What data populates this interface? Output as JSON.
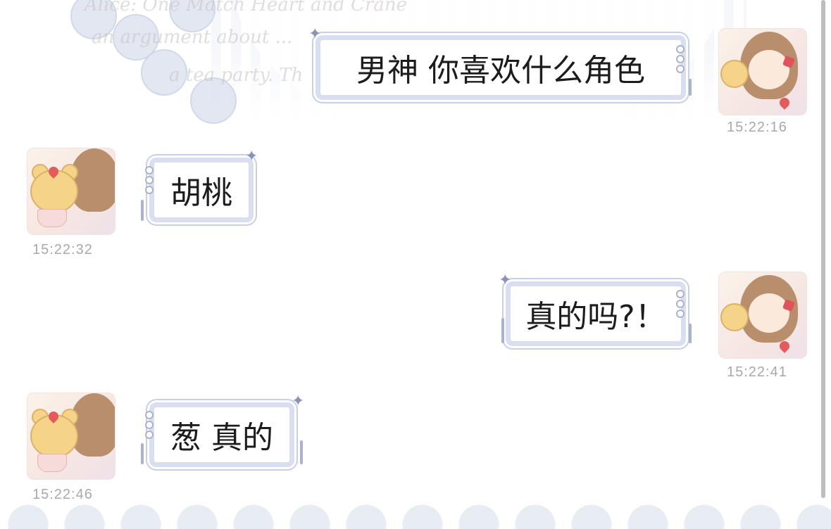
{
  "messages": [
    {
      "side": "right",
      "text": "男神 你喜欢什么角色",
      "time": "15:22:16"
    },
    {
      "side": "left",
      "text": "胡桃",
      "time": "15:22:32"
    },
    {
      "side": "right",
      "text": "真的吗?！",
      "time": "15:22:41"
    },
    {
      "side": "left",
      "text": "葱 真的",
      "time": "15:22:46"
    }
  ],
  "background": {
    "script_lines": [
      "Alice: One Match Heart and Crane",
      "an argument about ...",
      "a tea party. Th"
    ]
  },
  "colors": {
    "bubble_border": "#d9def0",
    "timestamp": "#a9a9a9",
    "text": "#1c1c1c"
  }
}
